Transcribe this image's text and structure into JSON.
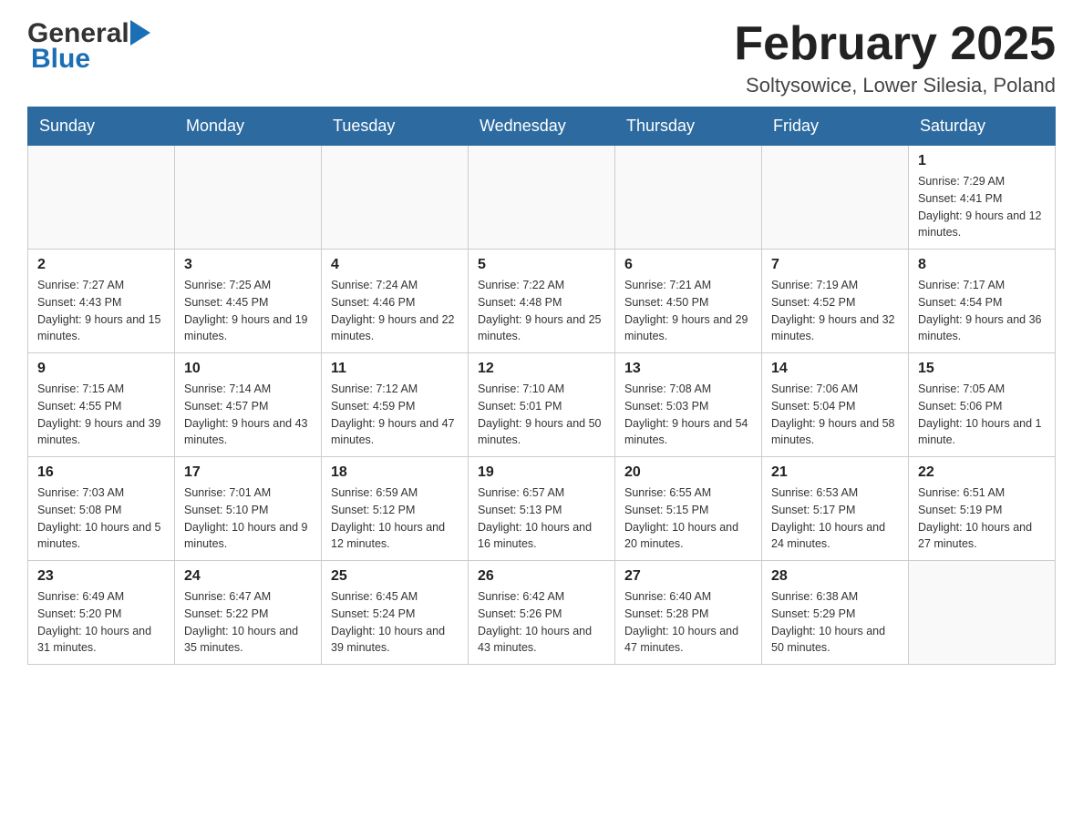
{
  "header": {
    "logo_general": "General",
    "logo_blue": "Blue",
    "month_title": "February 2025",
    "location": "Soltysowice, Lower Silesia, Poland"
  },
  "weekdays": [
    "Sunday",
    "Monday",
    "Tuesday",
    "Wednesday",
    "Thursday",
    "Friday",
    "Saturday"
  ],
  "weeks": [
    [
      {
        "day": "",
        "info": ""
      },
      {
        "day": "",
        "info": ""
      },
      {
        "day": "",
        "info": ""
      },
      {
        "day": "",
        "info": ""
      },
      {
        "day": "",
        "info": ""
      },
      {
        "day": "",
        "info": ""
      },
      {
        "day": "1",
        "info": "Sunrise: 7:29 AM\nSunset: 4:41 PM\nDaylight: 9 hours and 12 minutes."
      }
    ],
    [
      {
        "day": "2",
        "info": "Sunrise: 7:27 AM\nSunset: 4:43 PM\nDaylight: 9 hours and 15 minutes."
      },
      {
        "day": "3",
        "info": "Sunrise: 7:25 AM\nSunset: 4:45 PM\nDaylight: 9 hours and 19 minutes."
      },
      {
        "day": "4",
        "info": "Sunrise: 7:24 AM\nSunset: 4:46 PM\nDaylight: 9 hours and 22 minutes."
      },
      {
        "day": "5",
        "info": "Sunrise: 7:22 AM\nSunset: 4:48 PM\nDaylight: 9 hours and 25 minutes."
      },
      {
        "day": "6",
        "info": "Sunrise: 7:21 AM\nSunset: 4:50 PM\nDaylight: 9 hours and 29 minutes."
      },
      {
        "day": "7",
        "info": "Sunrise: 7:19 AM\nSunset: 4:52 PM\nDaylight: 9 hours and 32 minutes."
      },
      {
        "day": "8",
        "info": "Sunrise: 7:17 AM\nSunset: 4:54 PM\nDaylight: 9 hours and 36 minutes."
      }
    ],
    [
      {
        "day": "9",
        "info": "Sunrise: 7:15 AM\nSunset: 4:55 PM\nDaylight: 9 hours and 39 minutes."
      },
      {
        "day": "10",
        "info": "Sunrise: 7:14 AM\nSunset: 4:57 PM\nDaylight: 9 hours and 43 minutes."
      },
      {
        "day": "11",
        "info": "Sunrise: 7:12 AM\nSunset: 4:59 PM\nDaylight: 9 hours and 47 minutes."
      },
      {
        "day": "12",
        "info": "Sunrise: 7:10 AM\nSunset: 5:01 PM\nDaylight: 9 hours and 50 minutes."
      },
      {
        "day": "13",
        "info": "Sunrise: 7:08 AM\nSunset: 5:03 PM\nDaylight: 9 hours and 54 minutes."
      },
      {
        "day": "14",
        "info": "Sunrise: 7:06 AM\nSunset: 5:04 PM\nDaylight: 9 hours and 58 minutes."
      },
      {
        "day": "15",
        "info": "Sunrise: 7:05 AM\nSunset: 5:06 PM\nDaylight: 10 hours and 1 minute."
      }
    ],
    [
      {
        "day": "16",
        "info": "Sunrise: 7:03 AM\nSunset: 5:08 PM\nDaylight: 10 hours and 5 minutes."
      },
      {
        "day": "17",
        "info": "Sunrise: 7:01 AM\nSunset: 5:10 PM\nDaylight: 10 hours and 9 minutes."
      },
      {
        "day": "18",
        "info": "Sunrise: 6:59 AM\nSunset: 5:12 PM\nDaylight: 10 hours and 12 minutes."
      },
      {
        "day": "19",
        "info": "Sunrise: 6:57 AM\nSunset: 5:13 PM\nDaylight: 10 hours and 16 minutes."
      },
      {
        "day": "20",
        "info": "Sunrise: 6:55 AM\nSunset: 5:15 PM\nDaylight: 10 hours and 20 minutes."
      },
      {
        "day": "21",
        "info": "Sunrise: 6:53 AM\nSunset: 5:17 PM\nDaylight: 10 hours and 24 minutes."
      },
      {
        "day": "22",
        "info": "Sunrise: 6:51 AM\nSunset: 5:19 PM\nDaylight: 10 hours and 27 minutes."
      }
    ],
    [
      {
        "day": "23",
        "info": "Sunrise: 6:49 AM\nSunset: 5:20 PM\nDaylight: 10 hours and 31 minutes."
      },
      {
        "day": "24",
        "info": "Sunrise: 6:47 AM\nSunset: 5:22 PM\nDaylight: 10 hours and 35 minutes."
      },
      {
        "day": "25",
        "info": "Sunrise: 6:45 AM\nSunset: 5:24 PM\nDaylight: 10 hours and 39 minutes."
      },
      {
        "day": "26",
        "info": "Sunrise: 6:42 AM\nSunset: 5:26 PM\nDaylight: 10 hours and 43 minutes."
      },
      {
        "day": "27",
        "info": "Sunrise: 6:40 AM\nSunset: 5:28 PM\nDaylight: 10 hours and 47 minutes."
      },
      {
        "day": "28",
        "info": "Sunrise: 6:38 AM\nSunset: 5:29 PM\nDaylight: 10 hours and 50 minutes."
      },
      {
        "day": "",
        "info": ""
      }
    ]
  ]
}
